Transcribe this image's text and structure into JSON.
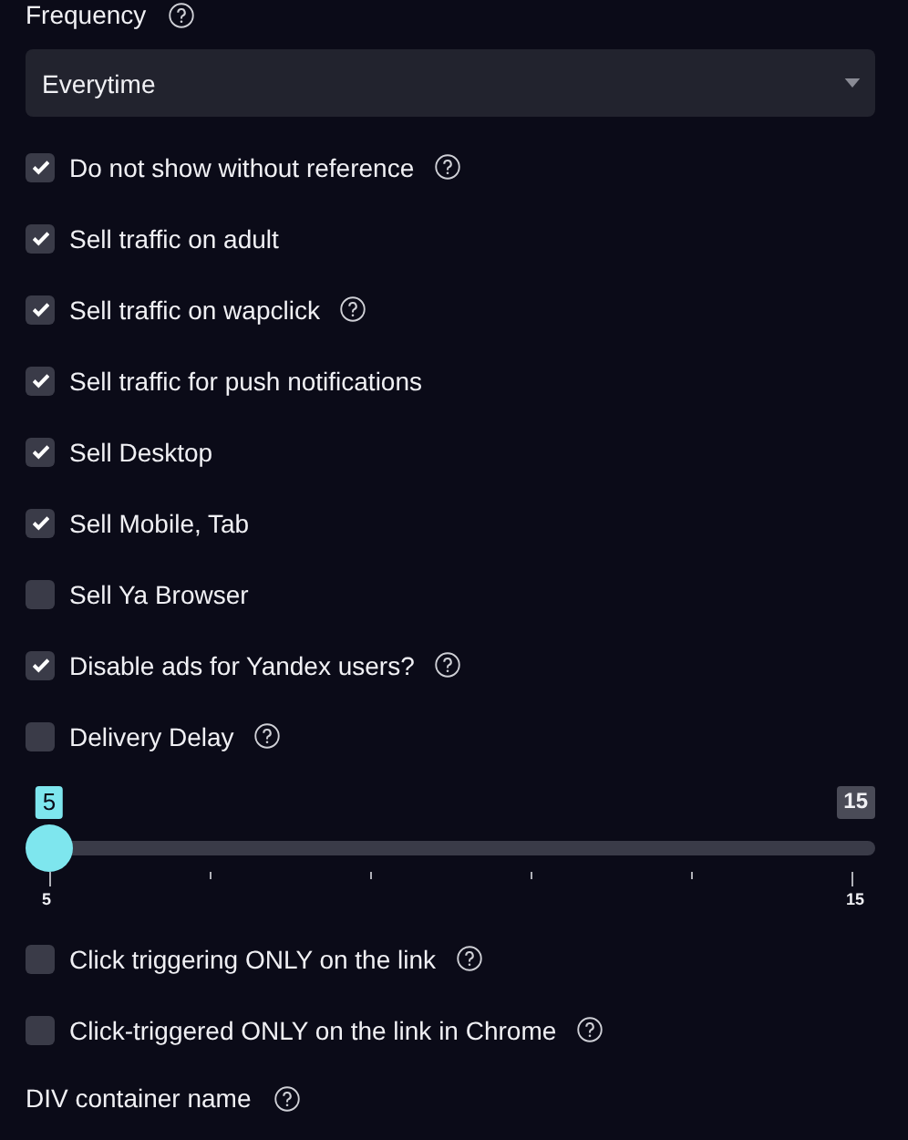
{
  "frequency": {
    "label": "Frequency",
    "has_help": true,
    "value": "Everytime"
  },
  "options_top": [
    {
      "label": "Do not show without reference",
      "checked": true,
      "has_help": true
    },
    {
      "label": "Sell traffic on adult",
      "checked": true,
      "has_help": false
    },
    {
      "label": "Sell traffic on wapclick",
      "checked": true,
      "has_help": true
    },
    {
      "label": "Sell traffic for push notifications",
      "checked": true,
      "has_help": false
    },
    {
      "label": "Sell Desktop",
      "checked": true,
      "has_help": false
    },
    {
      "label": "Sell Mobile, Tab",
      "checked": true,
      "has_help": false
    },
    {
      "label": "Sell Ya Browser",
      "checked": false,
      "has_help": false
    },
    {
      "label": "Disable ads for Yandex users?",
      "checked": true,
      "has_help": true
    },
    {
      "label": "Delivery Delay",
      "checked": false,
      "has_help": true
    }
  ],
  "delay_slider": {
    "value": "5",
    "max_label": "15",
    "level": 0,
    "tick_labels": [
      "5",
      "15"
    ]
  },
  "options_bottom": [
    {
      "label": "Click triggering ONLY on the link",
      "checked": false,
      "has_help": true
    },
    {
      "label": "Click-triggered ONLY on the link in Chrome",
      "checked": false,
      "has_help": true
    }
  ],
  "div_container": {
    "label": "DIV container name",
    "has_help": true
  }
}
